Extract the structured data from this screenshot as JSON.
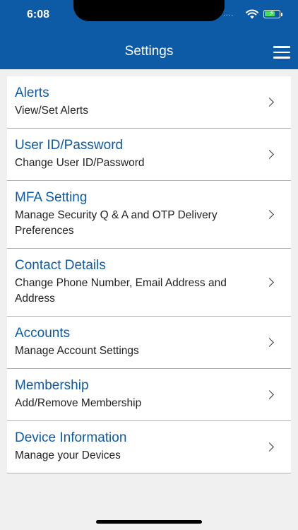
{
  "status_bar": {
    "time": "6:08",
    "signal_dots": "...."
  },
  "header": {
    "title": "Settings"
  },
  "settings": [
    {
      "title": "Alerts",
      "subtitle": "View/Set Alerts"
    },
    {
      "title": "User ID/Password",
      "subtitle": "Change User ID/Password"
    },
    {
      "title": "MFA Setting",
      "subtitle": "Manage Security Q & A and OTP Delivery Preferences"
    },
    {
      "title": "Contact Details",
      "subtitle": "Change Phone Number, Email Address and Address"
    },
    {
      "title": "Accounts",
      "subtitle": "Manage Account Settings"
    },
    {
      "title": "Membership",
      "subtitle": "Add/Remove Membership"
    },
    {
      "title": "Device Information",
      "subtitle": "Manage your Devices"
    }
  ],
  "icons": {
    "menu": "hamburger-menu-icon",
    "chevron": "chevron-right-icon",
    "wifi": "wifi-icon",
    "battery": "battery-charging-icon"
  },
  "colors": {
    "brand_blue": "#0d5aa7",
    "background": "#f0f0f0",
    "divider": "#9fb2c8",
    "battery_green": "#4cd964"
  }
}
